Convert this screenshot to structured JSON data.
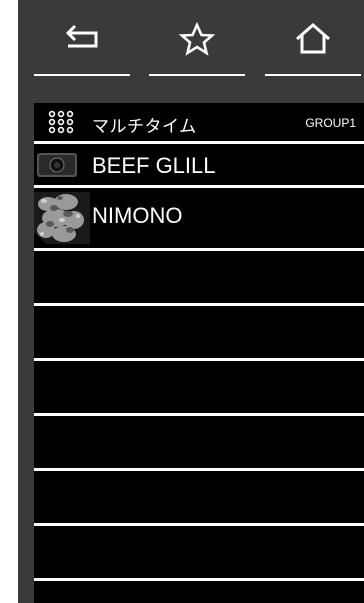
{
  "toolbar": {
    "back": {
      "icon": "back-arrow-icon"
    },
    "favorite": {
      "icon": "star-icon"
    },
    "home": {
      "icon": "home-icon"
    }
  },
  "header": {
    "title": "マルチタイム",
    "group": "GROUP1",
    "icon": "grid-dots-icon"
  },
  "items": [
    {
      "label": "BEEF GLILL",
      "icon": "camera-icon"
    },
    {
      "label": "NIMONO",
      "icon": "food-photo-thumbnail"
    }
  ],
  "colors": {
    "background": "#3a3a3a",
    "list_background": "#000000",
    "text": "#ffffff"
  }
}
